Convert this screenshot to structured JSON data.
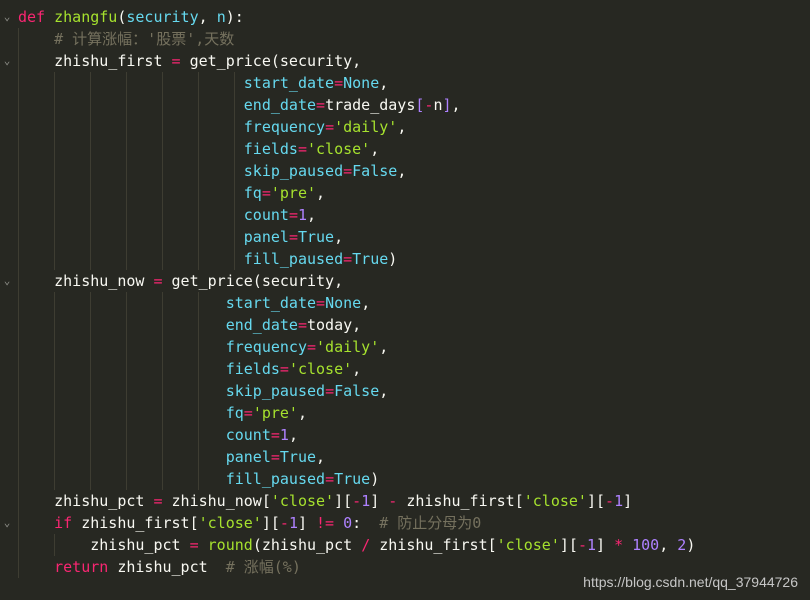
{
  "editor": {
    "lines": [
      {
        "fold": "⌄",
        "tokens": [
          [
            "kw",
            "def "
          ],
          [
            "fn",
            "zhangfu"
          ],
          [
            "bk",
            "("
          ],
          [
            "pm",
            "security"
          ],
          [
            "bk",
            ", "
          ],
          [
            "pm",
            "n"
          ],
          [
            "bk",
            "):"
          ]
        ]
      },
      {
        "fold": "",
        "tokens": [
          [
            "bk",
            "    "
          ],
          [
            "cm",
            "# 计算涨幅：'股票',天数"
          ]
        ]
      },
      {
        "fold": "⌄",
        "tokens": [
          [
            "bk",
            "    zhishu_first "
          ],
          [
            "op",
            "="
          ],
          [
            "bk",
            " get_price(security,"
          ]
        ]
      },
      {
        "fold": "",
        "tokens": [
          [
            "bk",
            "                         "
          ],
          [
            "pm",
            "start_date"
          ],
          [
            "op",
            "="
          ],
          [
            "pm",
            "None"
          ],
          [
            "bk",
            ","
          ]
        ]
      },
      {
        "fold": "",
        "tokens": [
          [
            "bk",
            "                         "
          ],
          [
            "pm",
            "end_date"
          ],
          [
            "op",
            "="
          ],
          [
            "bk",
            "trade_days"
          ],
          [
            "nm",
            "["
          ],
          [
            "op",
            "-"
          ],
          [
            "bk",
            "n"
          ],
          [
            "nm",
            "]"
          ],
          [
            "bk",
            ","
          ]
        ]
      },
      {
        "fold": "",
        "tokens": [
          [
            "bk",
            "                         "
          ],
          [
            "pm",
            "frequency"
          ],
          [
            "op",
            "="
          ],
          [
            "st2",
            "'daily'"
          ],
          [
            "bk",
            ","
          ]
        ]
      },
      {
        "fold": "",
        "tokens": [
          [
            "bk",
            "                         "
          ],
          [
            "pm",
            "fields"
          ],
          [
            "op",
            "="
          ],
          [
            "st2",
            "'close'"
          ],
          [
            "bk",
            ","
          ]
        ]
      },
      {
        "fold": "",
        "tokens": [
          [
            "bk",
            "                         "
          ],
          [
            "pm",
            "skip_paused"
          ],
          [
            "op",
            "="
          ],
          [
            "pm",
            "False"
          ],
          [
            "bk",
            ","
          ]
        ]
      },
      {
        "fold": "",
        "tokens": [
          [
            "bk",
            "                         "
          ],
          [
            "pm",
            "fq"
          ],
          [
            "op",
            "="
          ],
          [
            "st2",
            "'pre'"
          ],
          [
            "bk",
            ","
          ]
        ]
      },
      {
        "fold": "",
        "tokens": [
          [
            "bk",
            "                         "
          ],
          [
            "pm",
            "count"
          ],
          [
            "op",
            "="
          ],
          [
            "nm",
            "1"
          ],
          [
            "bk",
            ","
          ]
        ]
      },
      {
        "fold": "",
        "tokens": [
          [
            "bk",
            "                         "
          ],
          [
            "pm",
            "panel"
          ],
          [
            "op",
            "="
          ],
          [
            "pm",
            "True"
          ],
          [
            "bk",
            ","
          ]
        ]
      },
      {
        "fold": "",
        "tokens": [
          [
            "bk",
            "                         "
          ],
          [
            "pm",
            "fill_paused"
          ],
          [
            "op",
            "="
          ],
          [
            "pm",
            "True"
          ],
          [
            "bk",
            ")"
          ]
        ]
      },
      {
        "fold": "⌄",
        "tokens": [
          [
            "bk",
            "    zhishu_now "
          ],
          [
            "op",
            "="
          ],
          [
            "bk",
            " get_price(security,"
          ]
        ]
      },
      {
        "fold": "",
        "tokens": [
          [
            "bk",
            "                       "
          ],
          [
            "pm",
            "start_date"
          ],
          [
            "op",
            "="
          ],
          [
            "pm",
            "None"
          ],
          [
            "bk",
            ","
          ]
        ]
      },
      {
        "fold": "",
        "tokens": [
          [
            "bk",
            "                       "
          ],
          [
            "pm",
            "end_date"
          ],
          [
            "op",
            "="
          ],
          [
            "bk",
            "today,"
          ]
        ]
      },
      {
        "fold": "",
        "tokens": [
          [
            "bk",
            "                       "
          ],
          [
            "pm",
            "frequency"
          ],
          [
            "op",
            "="
          ],
          [
            "st2",
            "'daily'"
          ],
          [
            "bk",
            ","
          ]
        ]
      },
      {
        "fold": "",
        "tokens": [
          [
            "bk",
            "                       "
          ],
          [
            "pm",
            "fields"
          ],
          [
            "op",
            "="
          ],
          [
            "st2",
            "'close'"
          ],
          [
            "bk",
            ","
          ]
        ]
      },
      {
        "fold": "",
        "tokens": [
          [
            "bk",
            "                       "
          ],
          [
            "pm",
            "skip_paused"
          ],
          [
            "op",
            "="
          ],
          [
            "pm",
            "False"
          ],
          [
            "bk",
            ","
          ]
        ]
      },
      {
        "fold": "",
        "tokens": [
          [
            "bk",
            "                       "
          ],
          [
            "pm",
            "fq"
          ],
          [
            "op",
            "="
          ],
          [
            "st2",
            "'pre'"
          ],
          [
            "bk",
            ","
          ]
        ]
      },
      {
        "fold": "",
        "tokens": [
          [
            "bk",
            "                       "
          ],
          [
            "pm",
            "count"
          ],
          [
            "op",
            "="
          ],
          [
            "nm",
            "1"
          ],
          [
            "bk",
            ","
          ]
        ]
      },
      {
        "fold": "",
        "tokens": [
          [
            "bk",
            "                       "
          ],
          [
            "pm",
            "panel"
          ],
          [
            "op",
            "="
          ],
          [
            "pm",
            "True"
          ],
          [
            "bk",
            ","
          ]
        ]
      },
      {
        "fold": "",
        "tokens": [
          [
            "bk",
            "                       "
          ],
          [
            "pm",
            "fill_paused"
          ],
          [
            "op",
            "="
          ],
          [
            "pm",
            "True"
          ],
          [
            "bk",
            ")"
          ]
        ]
      },
      {
        "fold": "",
        "tokens": [
          [
            "bk",
            "    zhishu_pct "
          ],
          [
            "op",
            "="
          ],
          [
            "bk",
            " zhishu_now["
          ],
          [
            "st2",
            "'close'"
          ],
          [
            "bk",
            "]["
          ],
          [
            "op",
            "-"
          ],
          [
            "nm",
            "1"
          ],
          [
            "bk",
            "] "
          ],
          [
            "op",
            "-"
          ],
          [
            "bk",
            " zhishu_first["
          ],
          [
            "st2",
            "'close'"
          ],
          [
            "bk",
            "]["
          ],
          [
            "op",
            "-"
          ],
          [
            "nm",
            "1"
          ],
          [
            "bk",
            "]"
          ]
        ]
      },
      {
        "fold": "⌄",
        "tokens": [
          [
            "bk",
            "    "
          ],
          [
            "kw",
            "if"
          ],
          [
            "bk",
            " zhishu_first["
          ],
          [
            "st2",
            "'close'"
          ],
          [
            "bk",
            "]["
          ],
          [
            "op",
            "-"
          ],
          [
            "nm",
            "1"
          ],
          [
            "bk",
            "] "
          ],
          [
            "op",
            "!="
          ],
          [
            "bk",
            " "
          ],
          [
            "nm",
            "0"
          ],
          [
            "bk",
            ":  "
          ],
          [
            "cm",
            "# 防止分母为0"
          ]
        ]
      },
      {
        "fold": "",
        "tokens": [
          [
            "bk",
            "        zhishu_pct "
          ],
          [
            "op",
            "="
          ],
          [
            "bk",
            " "
          ],
          [
            "fn",
            "round"
          ],
          [
            "bk",
            "(zhishu_pct "
          ],
          [
            "op",
            "/"
          ],
          [
            "bk",
            " zhishu_first["
          ],
          [
            "st2",
            "'close'"
          ],
          [
            "bk",
            "]["
          ],
          [
            "op",
            "-"
          ],
          [
            "nm",
            "1"
          ],
          [
            "bk",
            "] "
          ],
          [
            "op",
            "*"
          ],
          [
            "bk",
            " "
          ],
          [
            "nm",
            "100"
          ],
          [
            "bk",
            ", "
          ],
          [
            "nm",
            "2"
          ],
          [
            "bk",
            ")"
          ]
        ]
      },
      {
        "fold": "",
        "tokens": [
          [
            "bk",
            "    "
          ],
          [
            "kw",
            "return"
          ],
          [
            "bk",
            " zhishu_pct  "
          ],
          [
            "cm",
            "# 涨幅(%)"
          ]
        ]
      }
    ]
  },
  "watermark": "https://blog.csdn.net/qq_37944726"
}
